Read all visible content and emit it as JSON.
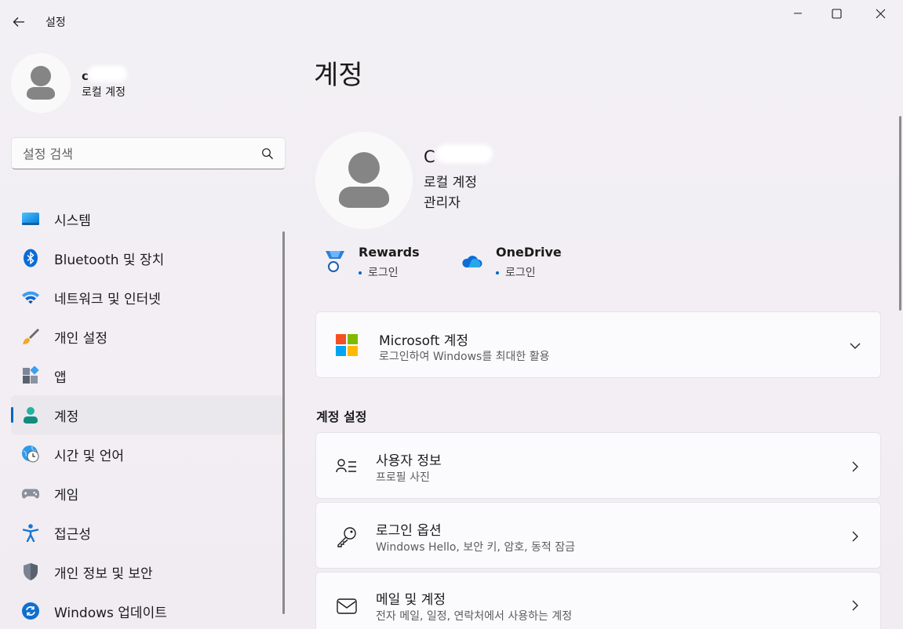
{
  "window": {
    "title": "설정"
  },
  "profile": {
    "name": "c",
    "account_type": "로컬 계정"
  },
  "search": {
    "placeholder": "설정 검색"
  },
  "nav": [
    {
      "label": "시스템",
      "icon": "display-icon"
    },
    {
      "label": "Bluetooth 및 장치",
      "icon": "bluetooth-icon"
    },
    {
      "label": "네트워크 및 인터넷",
      "icon": "wifi-icon"
    },
    {
      "label": "개인 설정",
      "icon": "brush-icon"
    },
    {
      "label": "앱",
      "icon": "apps-icon"
    },
    {
      "label": "계정",
      "icon": "person-icon",
      "active": true
    },
    {
      "label": "시간 및 언어",
      "icon": "clock-globe-icon"
    },
    {
      "label": "게임",
      "icon": "gamepad-icon"
    },
    {
      "label": "접근성",
      "icon": "accessibility-icon"
    },
    {
      "label": "개인 정보 및 보안",
      "icon": "shield-icon"
    },
    {
      "label": "Windows 업데이트",
      "icon": "update-icon"
    }
  ],
  "main": {
    "title": "계정",
    "account": {
      "name": "C",
      "type": "로컬 계정",
      "role": "관리자"
    },
    "services": [
      {
        "name": "Rewards",
        "status": "로그인",
        "icon": "rewards-medal-icon"
      },
      {
        "name": "OneDrive",
        "status": "로그인",
        "icon": "onedrive-cloud-icon"
      }
    ],
    "microsoft_account": {
      "title": "Microsoft 계정",
      "subtitle": "로그인하여 Windows를 최대한 활용"
    },
    "section_title": "계정 설정",
    "settings": [
      {
        "title": "사용자 정보",
        "subtitle": "프로필 사진",
        "icon": "user-info-icon"
      },
      {
        "title": "로그인 옵션",
        "subtitle": "Windows Hello, 보안 키, 암호, 동적 잠금",
        "icon": "key-icon"
      },
      {
        "title": "메일 및 계정",
        "subtitle": "전자 메일, 일정, 연락처에서 사용하는 계정",
        "icon": "mail-icon"
      }
    ]
  },
  "colors": {
    "accent": "#0067c0",
    "background": "#f3f0f5",
    "card": "#fbfafc"
  }
}
